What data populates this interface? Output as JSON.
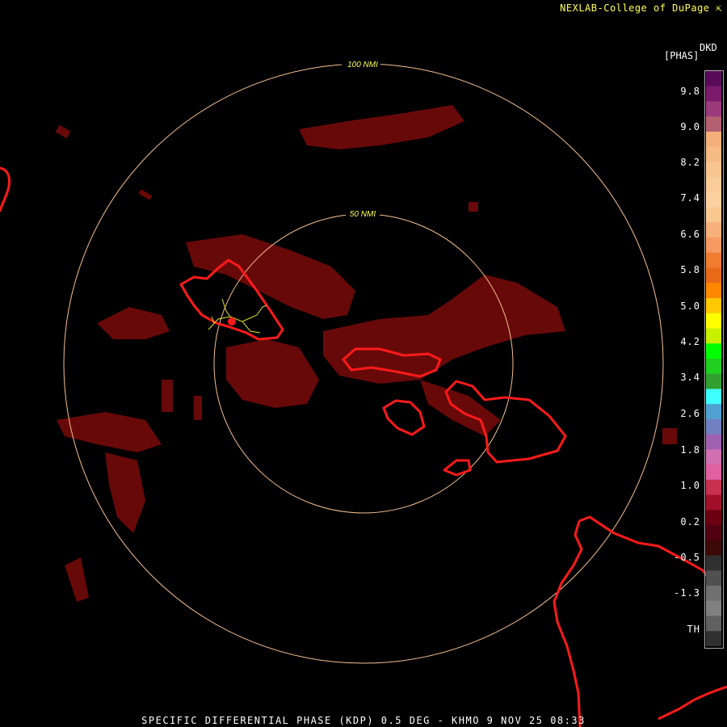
{
  "credit": "NEXLAB-College of DuPage",
  "credit_icon": "corner-arrow-icon",
  "units": {
    "top": "DKD",
    "label": "[PHAS]"
  },
  "rings": [
    {
      "label": "100 NMI"
    },
    {
      "label": "50 NMI"
    }
  ],
  "colorbar": {
    "labels": [
      "9.8",
      "9.0",
      "8.2",
      "7.4",
      "6.6",
      "5.8",
      "5.0",
      "4.2",
      "3.4",
      "2.6",
      "1.8",
      "1.0",
      "0.2",
      "-0.5",
      "-1.3",
      "TH"
    ],
    "colors": [
      "#5a0a5a",
      "#7a1a6a",
      "#9a3a7a",
      "#b36070",
      "#f4b07a",
      "#f6ba84",
      "#f8c490",
      "#f9cc98",
      "#fbd1a0",
      "#f9c890",
      "#f7b07c",
      "#f59a62",
      "#f07c30",
      "#e86a18",
      "#ff8800",
      "#ffc800",
      "#ffff00",
      "#c8f000",
      "#00ff00",
      "#20d020",
      "#30a030",
      "#40ffff",
      "#50a0d0",
      "#7080c0",
      "#a060b0",
      "#d070b0",
      "#e060a0",
      "#c83050",
      "#a01028",
      "#6a0010",
      "#500010",
      "#3c0808",
      "#303030",
      "#505050",
      "#707070",
      "#808080",
      "#606060",
      "#303030"
    ],
    "accent": "#ffff55"
  },
  "map": {
    "ring_color": "#f5c090",
    "coast_color": "#ff2020",
    "echo_color": "#7a0a0a",
    "road_color": "#e0e020"
  },
  "footer": "SPECIFIC DIFFERENTIAL PHASE (KDP) 0.5 DEG - KHMO 9 NOV 25 08:33"
}
